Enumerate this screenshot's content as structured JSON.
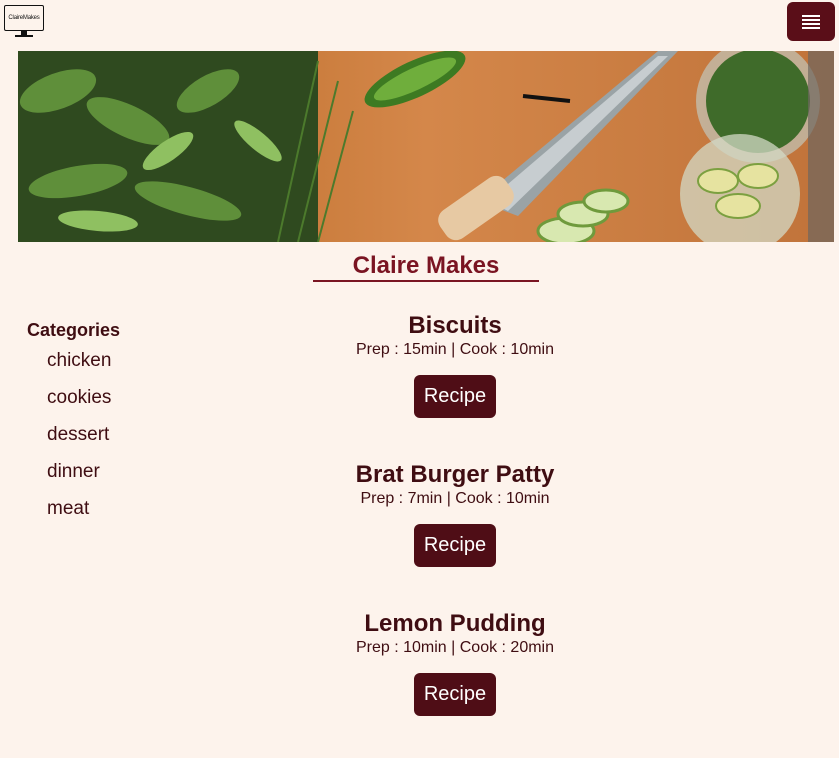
{
  "header": {
    "logo_text": "ClaireMakes",
    "menu_icon": "hamburger-icon"
  },
  "site": {
    "title": "Claire Makes"
  },
  "sidebar": {
    "heading": "Categories",
    "items": [
      "chicken",
      "cookies",
      "dessert",
      "dinner",
      "meat"
    ]
  },
  "recipes": [
    {
      "name": "Biscuits",
      "times": "Prep : 15min | Cook : 10min",
      "button": "Recipe"
    },
    {
      "name": "Brat Burger Patty",
      "times": "Prep : 7min | Cook : 10min",
      "button": "Recipe"
    },
    {
      "name": "Lemon Pudding",
      "times": "Prep : 10min | Cook : 20min",
      "button": "Recipe"
    }
  ],
  "colors": {
    "background": "#fdf3ec",
    "accent": "#4f0d16",
    "title": "#7a1422"
  }
}
